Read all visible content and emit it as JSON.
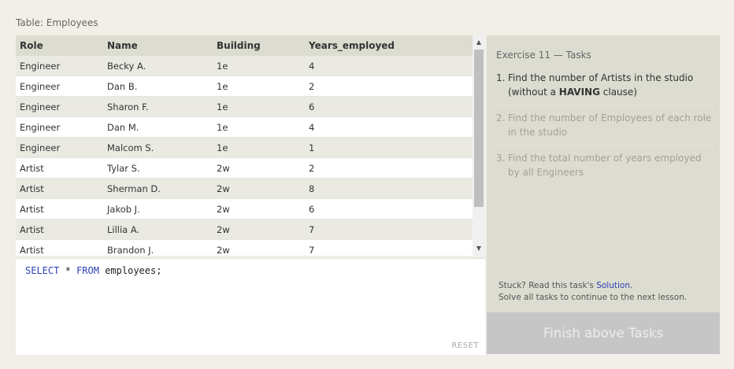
{
  "table_title": "Table: Employees",
  "columns": [
    "Role",
    "Name",
    "Building",
    "Years_employed"
  ],
  "rows": [
    [
      "Engineer",
      "Becky A.",
      "1e",
      "4"
    ],
    [
      "Engineer",
      "Dan B.",
      "1e",
      "2"
    ],
    [
      "Engineer",
      "Sharon F.",
      "1e",
      "6"
    ],
    [
      "Engineer",
      "Dan M.",
      "1e",
      "4"
    ],
    [
      "Engineer",
      "Malcom S.",
      "1e",
      "1"
    ],
    [
      "Artist",
      "Tylar S.",
      "2w",
      "2"
    ],
    [
      "Artist",
      "Sherman D.",
      "2w",
      "8"
    ],
    [
      "Artist",
      "Jakob J.",
      "2w",
      "6"
    ],
    [
      "Artist",
      "Lillia A.",
      "2w",
      "7"
    ],
    [
      "Artist",
      "Brandon J.",
      "2w",
      "7"
    ]
  ],
  "editor": {
    "kw_select": "SELECT",
    "star": "*",
    "kw_from": "FROM",
    "table": "employees;",
    "reset_label": "RESET"
  },
  "tasks": {
    "title": "Exercise 11 — Tasks",
    "items": [
      {
        "num": "1.",
        "text_before": "Find the number of Artists in the studio (without a ",
        "bold": "HAVING",
        "text_after": " clause)"
      },
      {
        "num": "2.",
        "text": "Find the number of Employees of each role in the studio"
      },
      {
        "num": "3.",
        "text": "Find the total number of years employed by all Engineers"
      }
    ],
    "stuck_prefix": "Stuck? Read this task's ",
    "solution_link": "Solution",
    "stuck_suffix": ".",
    "solve_note": "Solve all tasks to continue to the next lesson.",
    "finish_label": "Finish above Tasks"
  },
  "colors": {
    "keyword": "#2c3fb3",
    "panel": "#dcdcd1",
    "finish_button": "#c6c6c6"
  }
}
